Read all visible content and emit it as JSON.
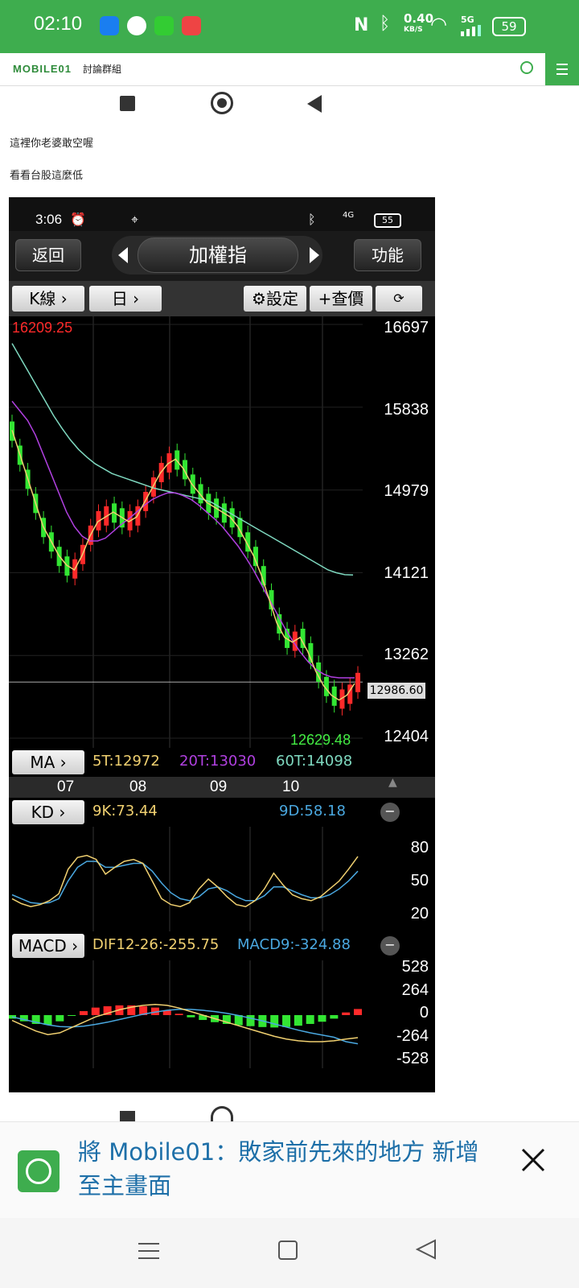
{
  "status_bar": {
    "time": "02:10",
    "speed_value": "0.40",
    "speed_unit": "KB/S",
    "network": "5G",
    "battery": "59"
  },
  "site_header": {
    "logo": "MOBILE01",
    "section": "討論群組"
  },
  "post": {
    "line1": "這裡你老婆敢空喔",
    "line2": "看看台股這麼低"
  },
  "embedded": {
    "status_time": "3:06",
    "status_net": "4G",
    "status_battery": "55",
    "back_label": "返回",
    "title": "加權指",
    "func_label": "功能",
    "kline_label": "K線",
    "period_label": "日",
    "settings_label": "設定",
    "quote_label": "+查價",
    "high_label": "16209.25",
    "low_label": "12629.48",
    "last_label": "12986.60",
    "ma_label": "MA",
    "ma5": "5T:12972",
    "ma20": "20T:13030",
    "ma60": "60T:14098",
    "kd_label": "KD",
    "k_value": "9K:73.44",
    "d_value": "9D:58.18",
    "macd_label": "MACD",
    "dif_value": "DIF12-26:-255.75",
    "macd_value": "MACD9:-324.88"
  },
  "chart_data": {
    "type": "candlestick",
    "price_axis": [
      "16697",
      "15838",
      "14979",
      "14121",
      "13262",
      "12404"
    ],
    "price_ylim": [
      12404,
      16697
    ],
    "month_labels": [
      "07",
      "08",
      "09",
      "10"
    ],
    "kd_axis": [
      "80",
      "50",
      "20"
    ],
    "macd_axis": [
      "528",
      "264",
      "0",
      "-264",
      "-528"
    ],
    "ma5": [
      15600,
      15350,
      15100,
      14850,
      14600,
      14450,
      14300,
      14200,
      14150,
      14300,
      14500,
      14650,
      14700,
      14750,
      14700,
      14650,
      14700,
      14850,
      15000,
      15150,
      15250,
      15300,
      15200,
      15050,
      14950,
      14850,
      14800,
      14750,
      14700,
      14600,
      14450,
      14300,
      14100,
      13850,
      13600,
      13450,
      13400,
      13450,
      13300,
      13100,
      12950,
      12850,
      12800,
      12850,
      12972
    ],
    "ma20": [
      15900,
      15800,
      15700,
      15550,
      15350,
      15150,
      14950,
      14750,
      14600,
      14500,
      14450,
      14450,
      14480,
      14550,
      14620,
      14680,
      14750,
      14820,
      14880,
      14920,
      14950,
      14950,
      14920,
      14880,
      14820,
      14750,
      14680,
      14600,
      14500,
      14400,
      14280,
      14150,
      14000,
      13850,
      13700,
      13550,
      13420,
      13300,
      13200,
      13120,
      13070,
      13040,
      13030,
      13030,
      13030
    ],
    "ma60": [
      16500,
      16350,
      16200,
      16050,
      15900,
      15750,
      15620,
      15500,
      15400,
      15320,
      15250,
      15200,
      15150,
      15120,
      15090,
      15060,
      15030,
      15000,
      14980,
      14960,
      14940,
      14920,
      14900,
      14880,
      14850,
      14800,
      14750,
      14700,
      14650,
      14600,
      14550,
      14500,
      14450,
      14400,
      14350,
      14300,
      14250,
      14200,
      14150,
      14120,
      14100,
      14098
    ],
    "k_series": [
      30,
      25,
      22,
      24,
      28,
      35,
      60,
      72,
      74,
      70,
      55,
      62,
      68,
      70,
      66,
      48,
      30,
      24,
      22,
      26,
      40,
      50,
      42,
      32,
      24,
      22,
      28,
      40,
      56,
      44,
      34,
      30,
      28,
      32,
      40,
      48,
      60,
      73
    ],
    "d_series": [
      34,
      30,
      26,
      25,
      26,
      30,
      48,
      62,
      68,
      68,
      62,
      62,
      64,
      66,
      66,
      58,
      46,
      36,
      30,
      28,
      32,
      40,
      42,
      38,
      32,
      28,
      28,
      33,
      42,
      42,
      38,
      34,
      31,
      31,
      34,
      40,
      48,
      58
    ],
    "dif_series": [
      -60,
      -120,
      -180,
      -220,
      -200,
      -140,
      -80,
      -20,
      20,
      60,
      90,
      110,
      120,
      110,
      80,
      40,
      0,
      -40,
      -80,
      -120,
      -160,
      -200,
      -240,
      -270,
      -290,
      -300,
      -300,
      -290,
      -270,
      -255
    ],
    "macd_series": [
      -20,
      -50,
      -80,
      -110,
      -130,
      -135,
      -125,
      -105,
      -80,
      -50,
      -20,
      10,
      35,
      55,
      65,
      65,
      55,
      40,
      20,
      -5,
      -35,
      -65,
      -100,
      -135,
      -170,
      -200,
      -225,
      -250,
      -300,
      -324
    ],
    "osc_series": [
      -40,
      -70,
      -100,
      -110,
      -70,
      -5,
      45,
      85,
      100,
      110,
      110,
      100,
      85,
      55,
      15,
      -25,
      -55,
      -80,
      -100,
      -115,
      -125,
      -135,
      -140,
      -135,
      -120,
      -100,
      -75,
      -40,
      30,
      69
    ]
  },
  "banner": {
    "text": "將 Mobile01：敗家前先來的地方 新增至主畫面"
  },
  "colors": {
    "brand_green": "#3ead4e",
    "up_red": "#ff2a2a",
    "down_green": "#33e633",
    "ma5_color": "#f0d070",
    "ma20_color": "#b040e0",
    "ma60_color": "#7fd9c0",
    "k_color": "#f0d070",
    "d_color": "#4aa8e0"
  }
}
